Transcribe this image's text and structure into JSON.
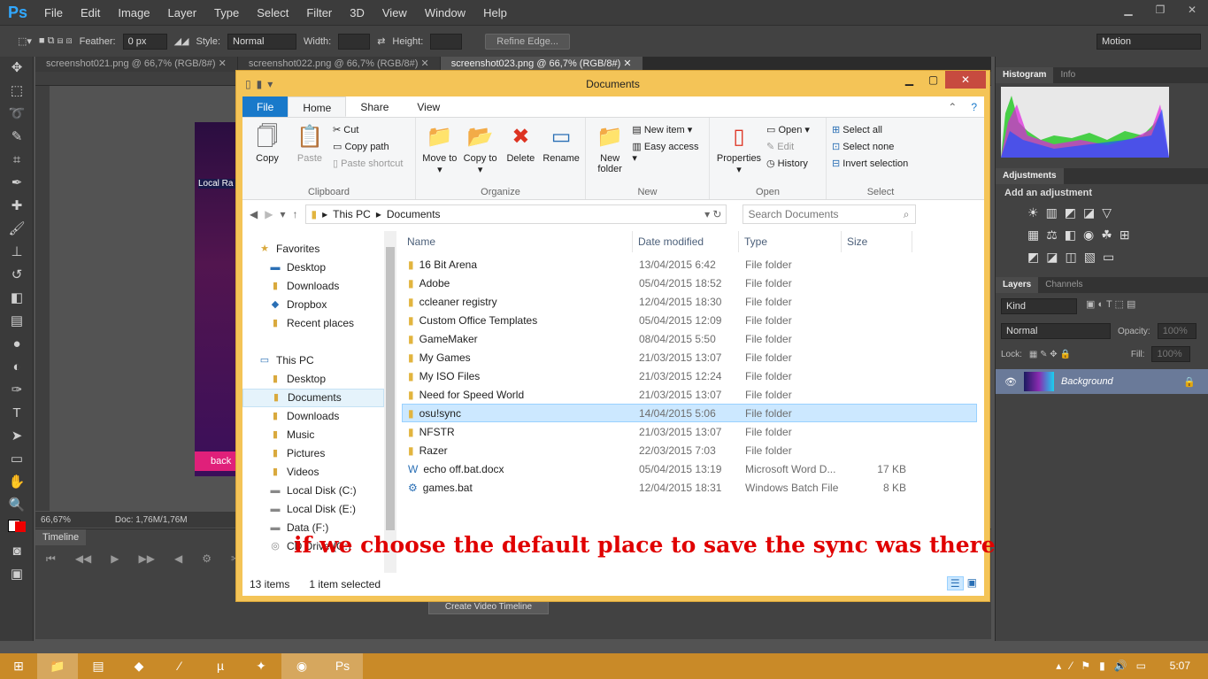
{
  "ps": {
    "logo": "Ps",
    "menu": [
      "File",
      "Edit",
      "Image",
      "Layer",
      "Type",
      "Select",
      "Filter",
      "3D",
      "View",
      "Window",
      "Help"
    ],
    "options": {
      "feather_label": "Feather:",
      "feather_value": "0 px",
      "style_label": "Style:",
      "style_value": "Normal",
      "width_label": "Width:",
      "height_label": "Height:",
      "refine_edge": "Refine Edge...",
      "workspace": "Motion"
    },
    "tabs": [
      "screenshot021.png @ 66,7% (RGB/8#)",
      "screenshot022.png @ 66,7% (RGB/8#)",
      "screenshot023.png @ 66,7% (RGB/8#)"
    ],
    "status": {
      "zoom": "66,67%",
      "doc": "Doc: 1,76M/1,76M"
    },
    "timeline": {
      "title": "Timeline",
      "create_button": "Create Video Timeline"
    },
    "panels": {
      "histogram_tab": "Histogram",
      "info_tab": "Info",
      "adjustments_tab": "Adjustments",
      "add_adjustment": "Add an adjustment",
      "layers_tab": "Layers",
      "channels_tab": "Channels",
      "kind": "Kind",
      "blend": "Normal",
      "opacity_label": "Opacity:",
      "opacity": "100%",
      "lock_label": "Lock:",
      "fill_label": "Fill:",
      "fill": "100%",
      "layer_name": "Background"
    },
    "canvas_text": {
      "back": "back",
      "local_rank": "Local Ra"
    }
  },
  "explorer": {
    "title": "Documents",
    "ribbon_tabs": [
      "File",
      "Home",
      "Share",
      "View"
    ],
    "clipboard": {
      "copy": "Copy",
      "paste": "Paste",
      "cut": "Cut",
      "copy_path": "Copy path",
      "paste_shortcut": "Paste shortcut",
      "label": "Clipboard"
    },
    "organize": {
      "move_to": "Move to",
      "copy_to": "Copy to",
      "delete": "Delete",
      "rename": "Rename",
      "label": "Organize"
    },
    "new": {
      "new_folder": "New folder",
      "new_item": "New item",
      "easy_access": "Easy access",
      "label": "New"
    },
    "open": {
      "properties": "Properties",
      "open": "Open",
      "edit": "Edit",
      "history": "History",
      "label": "Open"
    },
    "select": {
      "select_all": "Select all",
      "select_none": "Select none",
      "invert": "Invert selection",
      "label": "Select"
    },
    "address": {
      "this_pc": "This PC",
      "documents": "Documents"
    },
    "search_placeholder": "Search Documents",
    "nav": {
      "favorites": "Favorites",
      "fav_items": [
        "Desktop",
        "Downloads",
        "Dropbox",
        "Recent places"
      ],
      "this_pc": "This PC",
      "pc_items": [
        "Desktop",
        "Documents",
        "Downloads",
        "Music",
        "Pictures",
        "Videos",
        "Local Disk (C:)",
        "Local Disk (E:)",
        "Data (F:)",
        "CD Drive (G:)"
      ]
    },
    "columns": [
      "Name",
      "Date modified",
      "Type",
      "Size"
    ],
    "files": [
      {
        "name": "16 Bit Arena",
        "date": "13/04/2015 6:42",
        "type": "File folder",
        "size": ""
      },
      {
        "name": "Adobe",
        "date": "05/04/2015 18:52",
        "type": "File folder",
        "size": ""
      },
      {
        "name": "ccleaner registry",
        "date": "12/04/2015 18:30",
        "type": "File folder",
        "size": ""
      },
      {
        "name": "Custom Office Templates",
        "date": "05/04/2015 12:09",
        "type": "File folder",
        "size": ""
      },
      {
        "name": "GameMaker",
        "date": "08/04/2015 5:50",
        "type": "File folder",
        "size": ""
      },
      {
        "name": "My Games",
        "date": "21/03/2015 13:07",
        "type": "File folder",
        "size": ""
      },
      {
        "name": "My ISO Files",
        "date": "21/03/2015 12:24",
        "type": "File folder",
        "size": ""
      },
      {
        "name": "Need for Speed World",
        "date": "21/03/2015 13:07",
        "type": "File folder",
        "size": ""
      },
      {
        "name": "osu!sync",
        "date": "14/04/2015 5:06",
        "type": "File folder",
        "size": ""
      },
      {
        "name": "NFSTR",
        "date": "21/03/2015 13:07",
        "type": "File folder",
        "size": ""
      },
      {
        "name": "Razer",
        "date": "22/03/2015 7:03",
        "type": "File folder",
        "size": ""
      },
      {
        "name": "echo off.bat.docx",
        "date": "05/04/2015 13:19",
        "type": "Microsoft Word D...",
        "size": "17 KB"
      },
      {
        "name": "games.bat",
        "date": "12/04/2015 18:31",
        "type": "Windows Batch File",
        "size": "8 KB"
      }
    ],
    "status": {
      "items": "13 items",
      "selected": "1 item selected"
    }
  },
  "annotation": "if we choose the default place to save the sync was there",
  "taskbar": {
    "clock": "5:07"
  },
  "colors": {
    "explorer_frame": "#f4c457",
    "taskbar": "#c98a28",
    "selection": "#cce8ff",
    "annotation": "#e00000"
  }
}
